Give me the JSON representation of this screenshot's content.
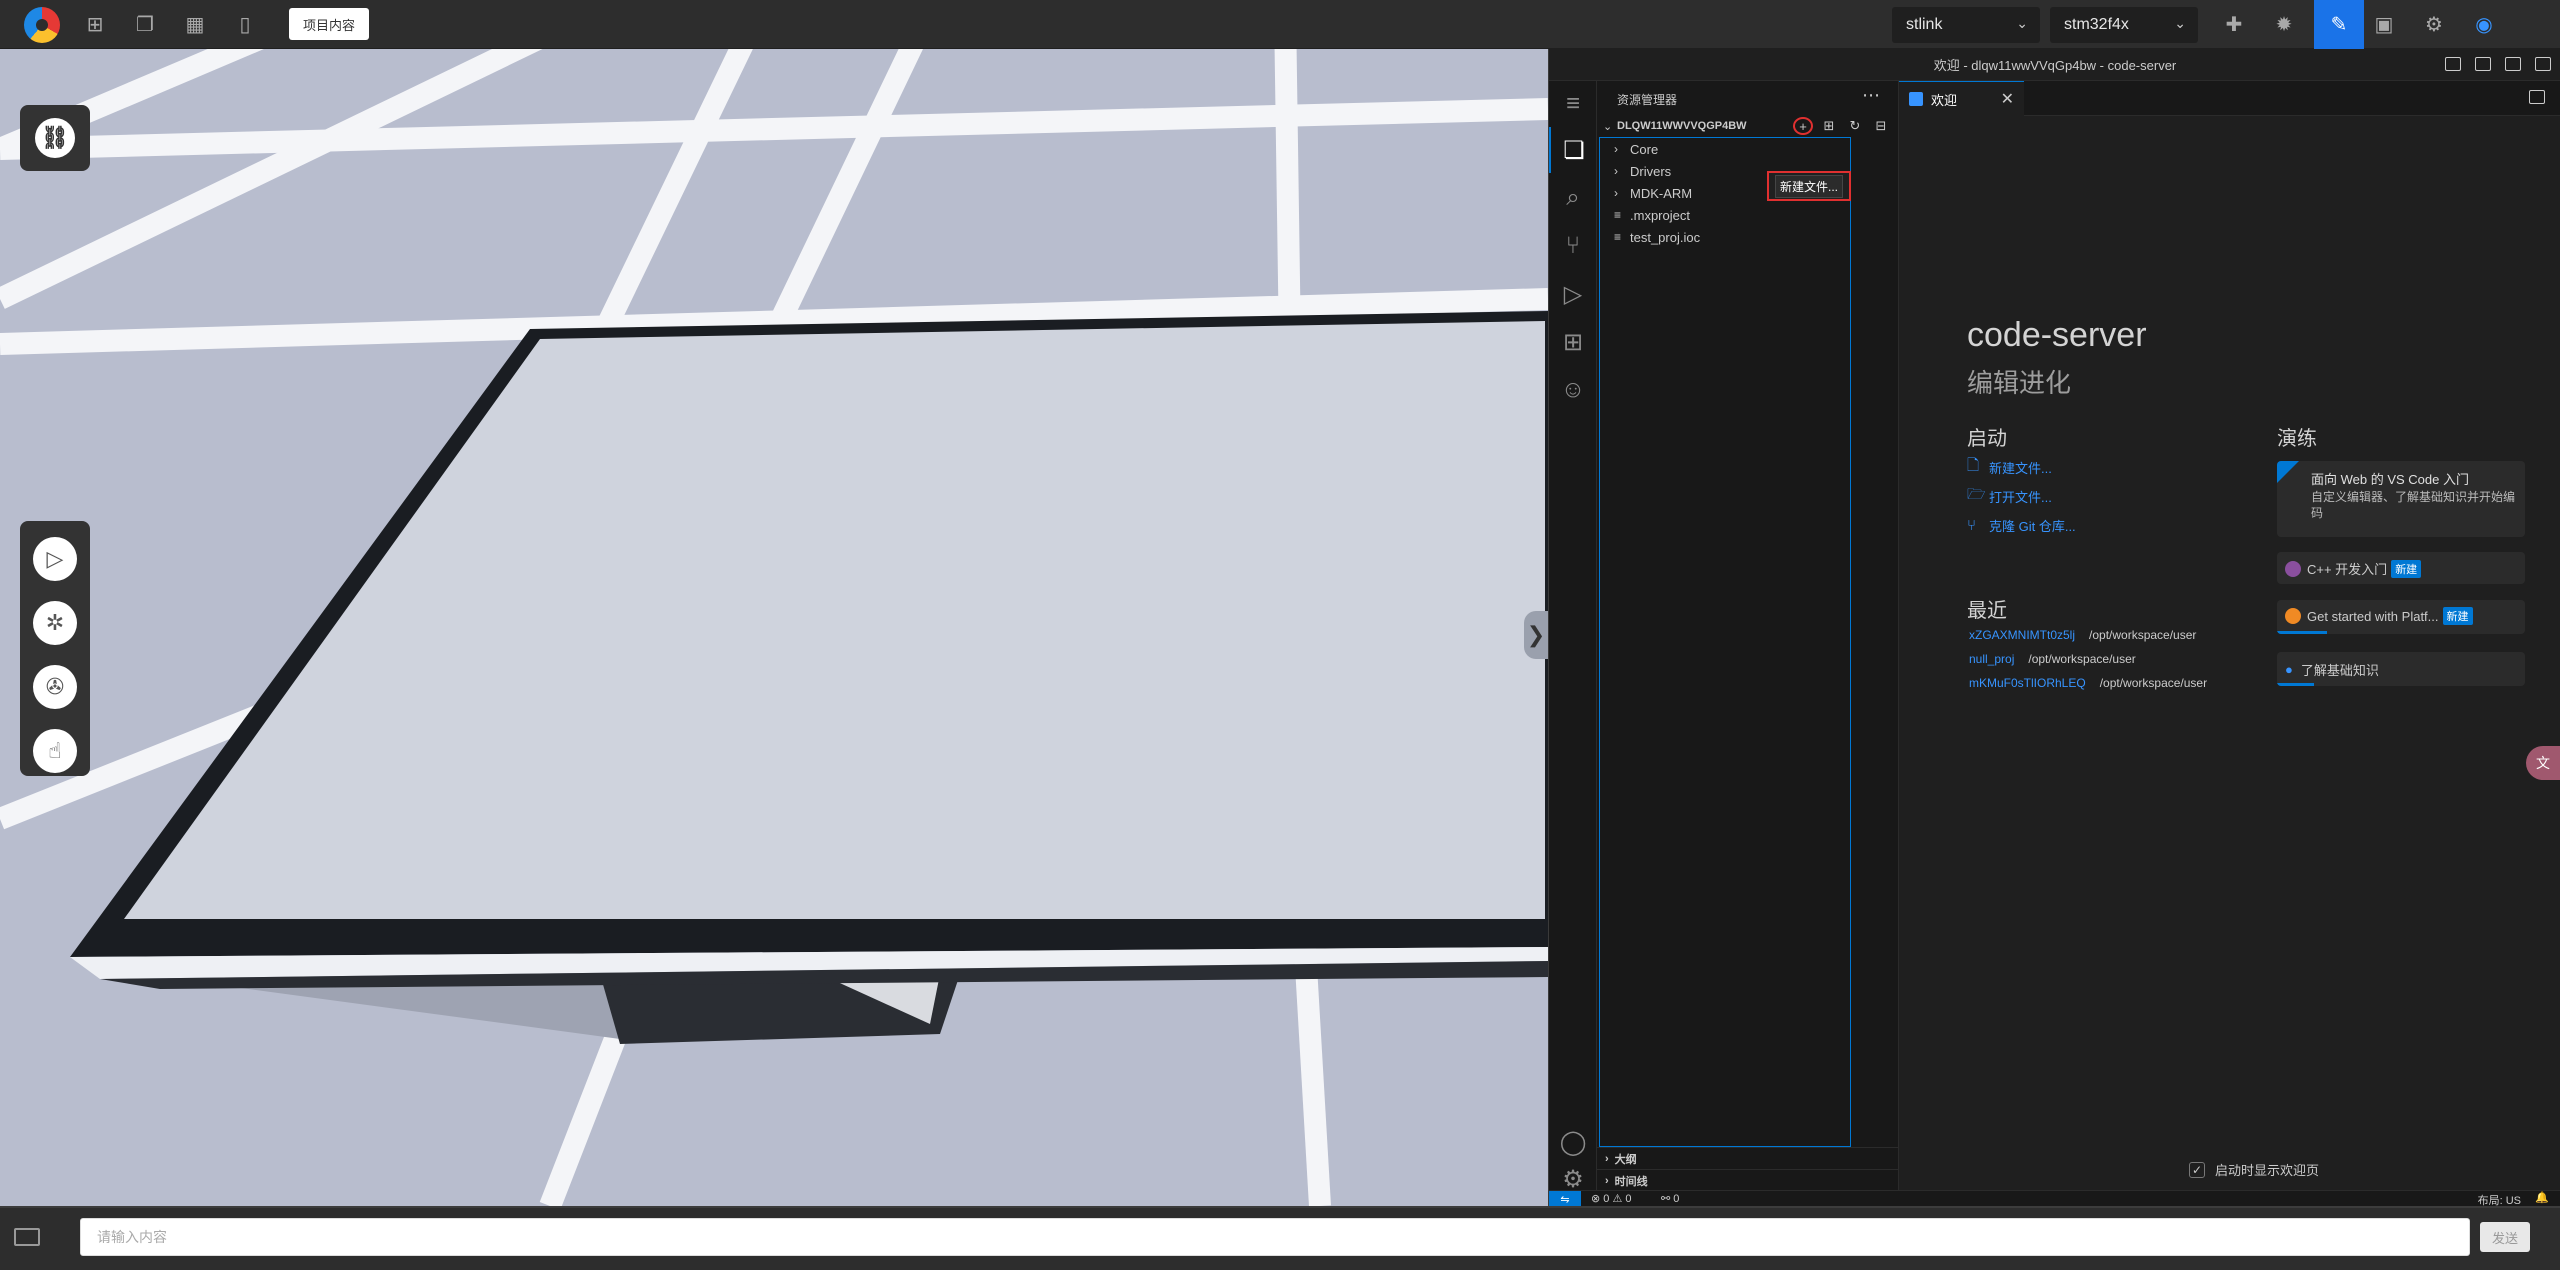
{
  "topbar": {
    "project_button": "项目内容",
    "debugger_select": "stlink",
    "chip_select": "stm32f4x",
    "icons": [
      "logo-icon",
      "folder-add-icon",
      "copy-icon",
      "apps-icon",
      "book-icon",
      "puzzle-icon",
      "bug-icon",
      "edit-icon",
      "save-icon",
      "chip-icon",
      "user-icon"
    ]
  },
  "viewport": {
    "collapse_glyph": "❯"
  },
  "vscode": {
    "window_title": "欢迎 - dlqw11wwVVqGp4bw - code-server",
    "sidebar": {
      "title": "资源管理器",
      "folder_name": "DLQW11WWVVQGP4BW",
      "tooltip": "新建文件...",
      "tree": [
        {
          "label": "Core",
          "kind": "folder"
        },
        {
          "label": "Drivers",
          "kind": "folder"
        },
        {
          "label": "MDK-ARM",
          "kind": "folder"
        },
        {
          "label": ".mxproject",
          "kind": "file"
        },
        {
          "label": "test_proj.ioc",
          "kind": "file"
        }
      ],
      "outline_label": "大纲",
      "timeline_label": "时间线"
    },
    "tab": {
      "label": "欢迎"
    },
    "welcome": {
      "title": "code-server",
      "subtitle": "编辑进化",
      "start_heading": "启动",
      "start_links": [
        "新建文件...",
        "打开文件...",
        "克隆 Git 仓库..."
      ],
      "recent_heading": "最近",
      "recent": [
        {
          "name": "xZGAXMNIMTt0z5lj",
          "path": "/opt/workspace/user"
        },
        {
          "name": "null_proj",
          "path": "/opt/workspace/user"
        },
        {
          "name": "mKMuF0sTlIORhLEQ",
          "path": "/opt/workspace/user"
        }
      ],
      "walkthrough_heading": "演练",
      "walkthroughs": [
        {
          "title": "面向 Web 的 VS Code 入门",
          "desc": "自定义编辑器、了解基础知识并开始编码",
          "progress": 0
        },
        {
          "title": "C++ 开发入门",
          "badge": "新建",
          "progress": 0
        },
        {
          "title": "Get started with Platf...",
          "badge": "新建",
          "progress": 0.2
        },
        {
          "title": "了解基础知识",
          "progress": 0.15
        }
      ],
      "show_on_startup": "启动时显示欢迎页"
    },
    "statusbar": {
      "problems": "⊗ 0 ⚠ 0",
      "ports": "⚯ 0",
      "layout": "布局: US"
    }
  },
  "bottom": {
    "input_placeholder": "请输入内容",
    "send_label": "发送"
  },
  "colors": {
    "accent": "#0078d4",
    "link": "#3794ff",
    "highlight_red": "#e03030"
  }
}
